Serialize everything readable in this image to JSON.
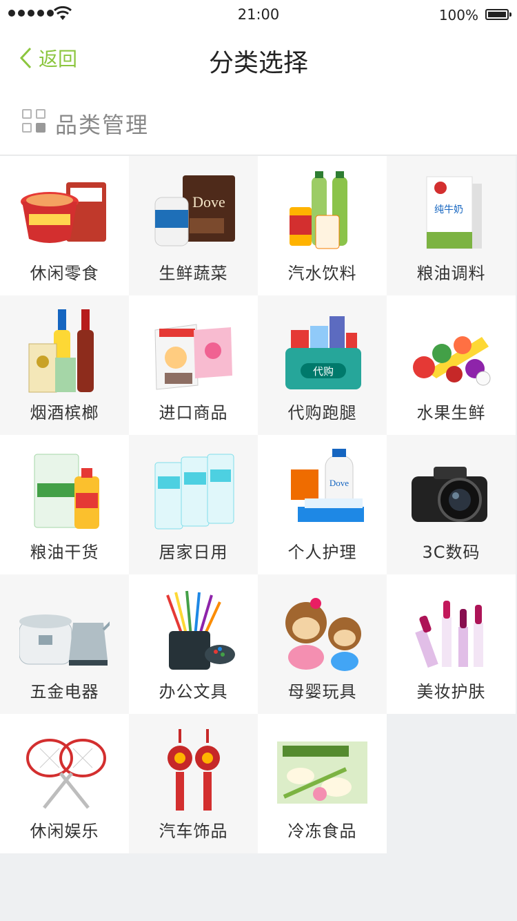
{
  "status": {
    "time": "21:00",
    "battery": "100%"
  },
  "nav": {
    "back_label": "返回",
    "title": "分类选择"
  },
  "section": {
    "title": "品类管理"
  },
  "categories": [
    {
      "label": "休闲零食",
      "icon": "snacks-icon"
    },
    {
      "label": "生鲜蔬菜",
      "icon": "candy-chocolate-icon"
    },
    {
      "label": "汽水饮料",
      "icon": "drinks-icon"
    },
    {
      "label": "粮油调料",
      "icon": "milk-carton-icon"
    },
    {
      "label": "烟酒槟榔",
      "icon": "beer-cigarettes-icon"
    },
    {
      "label": "进口商品",
      "icon": "imported-snacks-icon"
    },
    {
      "label": "代购跑腿",
      "icon": "errand-box-icon"
    },
    {
      "label": "水果生鲜",
      "icon": "fruits-vegetables-icon"
    },
    {
      "label": "粮油干货",
      "icon": "rice-oil-icon"
    },
    {
      "label": "居家日用",
      "icon": "tissue-rolls-icon"
    },
    {
      "label": "个人护理",
      "icon": "toiletries-icon"
    },
    {
      "label": "3C数码",
      "icon": "camera-icon"
    },
    {
      "label": "五金电器",
      "icon": "appliances-icon"
    },
    {
      "label": "办公文具",
      "icon": "stationery-icon"
    },
    {
      "label": "母婴玩具",
      "icon": "plush-toys-icon"
    },
    {
      "label": "美妆护肤",
      "icon": "lipstick-icon"
    },
    {
      "label": "休闲娱乐",
      "icon": "rackets-icon"
    },
    {
      "label": "汽车饰品",
      "icon": "chinese-knot-icon"
    },
    {
      "label": "冷冻食品",
      "icon": "frozen-food-icon"
    }
  ]
}
